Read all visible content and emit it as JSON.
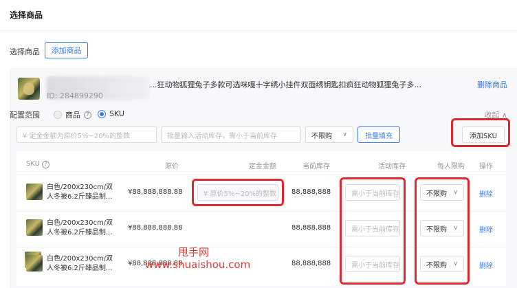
{
  "header": {
    "title": "选择商品"
  },
  "select_row": {
    "label": "选择商品",
    "add_button": "添加商品"
  },
  "product": {
    "name": "...狂动物狐狸兔子多款可选咪嘎十字绣小挂件双面绣钥匙扣疯狂动物狐狸兔子多...",
    "id_text": "ID: 284899290",
    "delete_label": "删除商品"
  },
  "config": {
    "label": "配置范围",
    "option_goods": "商品",
    "option_sku": "SKU",
    "selected": "SKU",
    "collapse_label": "收起 ∧",
    "help_glyph": "?"
  },
  "batch": {
    "amount_placeholder": "¥ 定金金额为原价5%~20%的整数",
    "stock_placeholder": "批量输入活动库存，需小于当前库存",
    "limit_value": "不限购",
    "fill_button": "批量填充",
    "add_sku_button": "添加SKU"
  },
  "table": {
    "headers": {
      "sku": "SKU",
      "price": "原价",
      "deposit": "定金金额",
      "current_stock": "当前库存",
      "activity_stock": "活动库存",
      "limit": "每人限购",
      "action": "操作"
    },
    "rows": [
      {
        "name_line1": "白色/200x230cm/双",
        "name_line2": "人冬被6.2斤臻品制...",
        "price": "¥88,888,888.88",
        "deposit_placeholder": "¥ 原价5%~20%的整数",
        "current_stock": "88,888,888",
        "activity_stock_placeholder": "需小于当前库存",
        "limit": "不限购",
        "action": "删除"
      },
      {
        "name_line1": "白色/200x230cm/双",
        "name_line2": "人冬被6.2斤臻品制...",
        "price": "¥88,888,888.88",
        "current_stock": "88,888,888",
        "activity_stock_placeholder": "需小于当前库存",
        "limit": "不限购",
        "action": "删除"
      },
      {
        "name_line1": "白色/200x230cm/双",
        "name_line2": "人冬被6.2斤臻品制...",
        "price": "¥88,888,888.88",
        "current_stock": "88,888,888",
        "activity_stock_placeholder": "需小于当前库存",
        "limit": "不限购",
        "action": "删除"
      }
    ]
  },
  "watermark": {
    "line1": "甩手网",
    "line2": "www.shuaishou.com"
  },
  "colors": {
    "accent": "#3b7cf6",
    "highlight": "#e0292c",
    "watermark": "#e53935"
  },
  "icons": {
    "chevron": "chevron-down-icon",
    "help": "help-circle-icon"
  }
}
